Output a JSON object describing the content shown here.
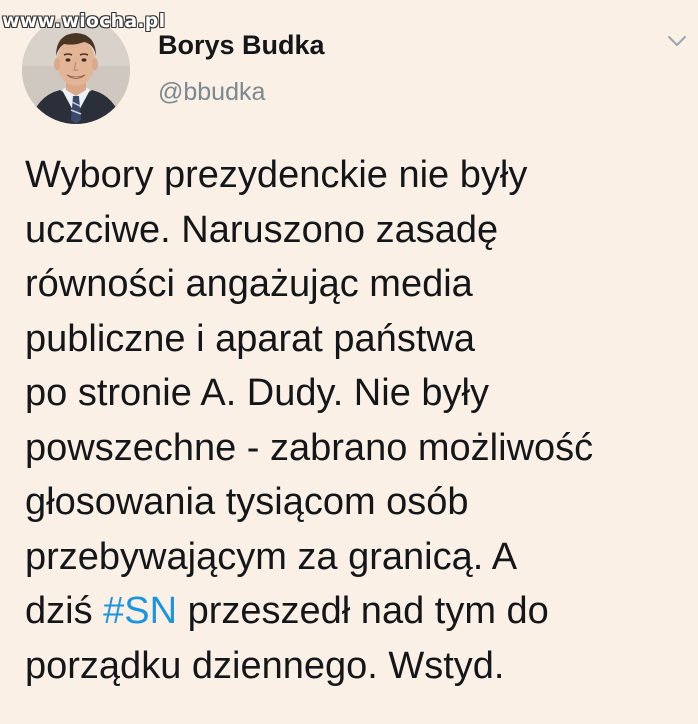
{
  "watermark": "www.wiocha.pl",
  "author": {
    "name": "Borys Budka",
    "handle": "@bbudka"
  },
  "icons": {
    "avatar": "profile-photo",
    "menu": "chevron-down-icon"
  },
  "colors": {
    "background": "#fbf0e6",
    "text": "#14171a",
    "handle": "#7c8891",
    "hashtag": "#1b95e0"
  },
  "tweet": {
    "line1": "Wybory prezydenckie nie były",
    "line2": "uczciwe. Naruszono zasadę",
    "line3": "równości angażując media",
    "line4": "publiczne i aparat państwa",
    "line5": "po stronie A. Dudy. Nie były",
    "line6": "powszechne - zabrano możliwość",
    "line7": "głosowania tysiącom osób",
    "line8": "przebywającym za granicą. A",
    "line9_before": "dziś ",
    "hashtag": "#SN",
    "line9_after": " przeszedł nad tym do",
    "line10": "porządku dziennego. Wstyd."
  }
}
